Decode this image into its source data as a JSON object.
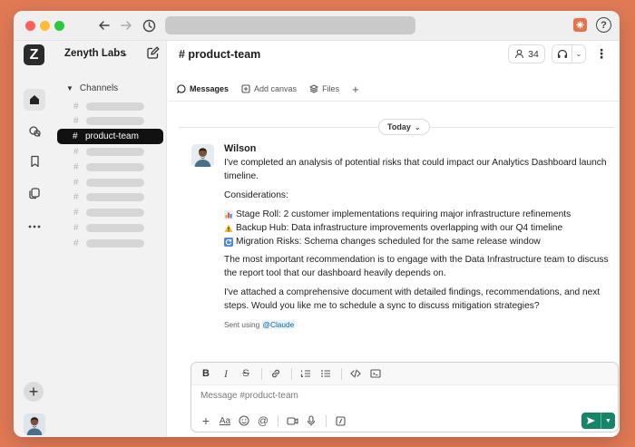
{
  "workspace": {
    "logo_letter": "Z",
    "name": "Zenyth Labs"
  },
  "sidebar": {
    "section_label": "Channels",
    "active_channel": "product-team"
  },
  "channel": {
    "title": "# product-team",
    "member_count": "34"
  },
  "tabs": [
    {
      "label": "Messages"
    },
    {
      "label": "Add canvas"
    },
    {
      "label": "Files"
    }
  ],
  "date_divider": "Today",
  "message": {
    "author": "Wilson",
    "intro": "I've completed an analysis of potential risks that could impact our Analytics Dashboard launch timeline.",
    "considerations_label": "Considerations:",
    "bullets": [
      {
        "icon": "bar-chart-icon",
        "text": "Stage Roll: 2 customer implementations requiring major infrastructure refinements"
      },
      {
        "icon": "warning-icon",
        "text": "Backup Hub: Data infrastructure improvements overlapping with our Q4 timeline"
      },
      {
        "icon": "refresh-icon",
        "text": "Migration Risks: Schema changes scheduled for the same release window"
      }
    ],
    "recommendation": "The most important recommendation is to engage with the Data Infrastructure team to discuss the report tool that our dashboard heavily depends on.",
    "closing": "I've attached a comprehensive document with detailed findings, recommendations, and next steps. Would you like me to schedule a sync to discuss mitigation strategies?",
    "sent_prefix": "Sent using",
    "sent_mention": "@Claude"
  },
  "composer": {
    "placeholder": "Message #product-team"
  },
  "colors": {
    "background": "#E07A55",
    "send_button": "#148567",
    "active_channel_bg": "#111111",
    "mention": "#1264a3"
  }
}
